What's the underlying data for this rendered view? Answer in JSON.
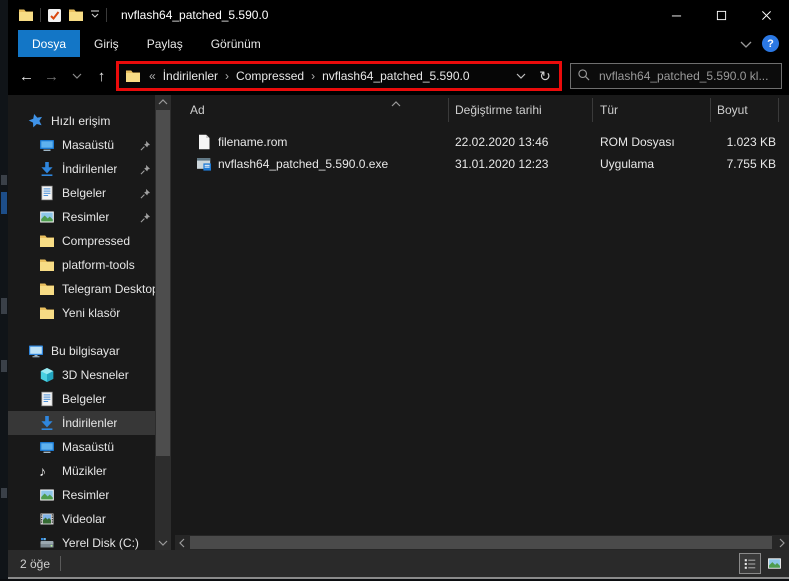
{
  "window": {
    "title": "nvflash64_patched_5.590.0"
  },
  "ribbon": {
    "tabs": [
      {
        "label": "Dosya",
        "active": true
      },
      {
        "label": "Giriş",
        "active": false
      },
      {
        "label": "Paylaş",
        "active": false
      },
      {
        "label": "Görünüm",
        "active": false
      }
    ]
  },
  "address_bar": {
    "breadcrumb": [
      "İndirilenler",
      "Compressed",
      "nvflash64_patched_5.590.0"
    ]
  },
  "search": {
    "placeholder": "nvflash64_patched_5.590.0 kl..."
  },
  "sidebar": {
    "quick_access": {
      "label": "Hızlı erişim",
      "items": [
        {
          "label": "Masaüstü",
          "pinned": true
        },
        {
          "label": "İndirilenler",
          "pinned": true
        },
        {
          "label": "Belgeler",
          "pinned": true
        },
        {
          "label": "Resimler",
          "pinned": true
        },
        {
          "label": "Compressed",
          "pinned": false
        },
        {
          "label": "platform-tools",
          "pinned": false
        },
        {
          "label": "Telegram Desktop",
          "pinned": false
        },
        {
          "label": "Yeni klasör",
          "pinned": false
        }
      ]
    },
    "this_pc": {
      "label": "Bu bilgisayar",
      "items": [
        {
          "label": "3D Nesneler",
          "selected": false
        },
        {
          "label": "Belgeler",
          "selected": false
        },
        {
          "label": "İndirilenler",
          "selected": true
        },
        {
          "label": "Masaüstü",
          "selected": false
        },
        {
          "label": "Müzikler",
          "selected": false
        },
        {
          "label": "Resimler",
          "selected": false
        },
        {
          "label": "Videolar",
          "selected": false
        },
        {
          "label": "Yerel Disk (C:)",
          "selected": false
        }
      ]
    }
  },
  "file_list": {
    "columns": {
      "name": "Ad",
      "modified": "Değiştirme tarihi",
      "type": "Tür",
      "size": "Boyut"
    },
    "rows": [
      {
        "name": "filename.rom",
        "modified": "22.02.2020 13:46",
        "type": "ROM Dosyası",
        "size": "1.023 KB"
      },
      {
        "name": "nvflash64_patched_5.590.0.exe",
        "modified": "31.01.2020 12:23",
        "type": "Uygulama",
        "size": "7.755 KB"
      }
    ]
  },
  "status_bar": {
    "item_count": "2 öğe"
  },
  "icons": {
    "back": "←",
    "forward": "→",
    "up": "↑",
    "refresh": "↻",
    "crumb_collapse": "«",
    "crumb_sep": "›",
    "music_note": "♪",
    "help": "?"
  },
  "colors": {
    "chrome_black": "#000000",
    "content_bg": "#191919",
    "accent_tab_blue": "#1376c6",
    "annotation_red": "#ea0b0b",
    "selection_gray": "#373737",
    "help_blue": "#2b78e4"
  }
}
